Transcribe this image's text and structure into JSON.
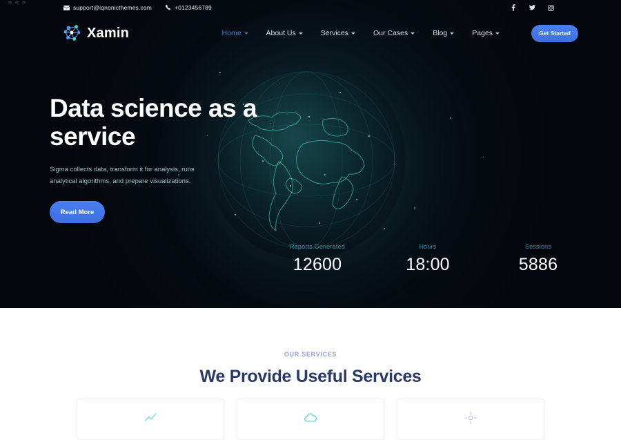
{
  "topbar": {
    "email": "support@iqnonicthemes.com",
    "phone": "+0123456789",
    "email_icon": "envelope-icon",
    "phone_icon": "phone-icon",
    "social": [
      {
        "name": "facebook-icon",
        "glyph": "f"
      },
      {
        "name": "twitter-icon",
        "glyph": "t"
      },
      {
        "name": "instagram-icon",
        "glyph": "i"
      }
    ]
  },
  "brand": {
    "name": "Xamin",
    "logo_icon": "molecule-network-icon"
  },
  "nav": {
    "items": [
      {
        "label": "Home",
        "active": true
      },
      {
        "label": "About Us",
        "active": false
      },
      {
        "label": "Services",
        "active": false
      },
      {
        "label": "Our Cases",
        "active": false
      },
      {
        "label": "Blog",
        "active": false
      },
      {
        "label": "Pages",
        "active": false
      }
    ],
    "cta": "Get Started"
  },
  "hero": {
    "title": "Data science as a service",
    "subtitle": "Sigma collects data, transform it for analysis, runs analytical algorithms, and prepare visualizations.",
    "button": "Read More",
    "background_icon": "globe-network-icon",
    "stats": [
      {
        "label": "Reports Generated",
        "value": "12600"
      },
      {
        "label": "Hours",
        "value": "18:00"
      },
      {
        "label": "Sessions",
        "value": "5886"
      }
    ]
  },
  "services": {
    "eyebrow": "OUR SERVICES",
    "title": "We Provide Useful Services",
    "cards": [
      {
        "icon": "analytics-chart-icon",
        "color": "#4fd8d0"
      },
      {
        "icon": "data-cloud-icon",
        "color": "#3ecfcf"
      },
      {
        "icon": "machine-learning-icon",
        "color": "#b9bce8"
      }
    ]
  },
  "colors": {
    "hero_bg": "#060910",
    "accent_blue": "#4a80e0",
    "accent_teal": "#2f93b3",
    "title_navy": "#2b3a63",
    "eyebrow": "#8f9fd4"
  }
}
